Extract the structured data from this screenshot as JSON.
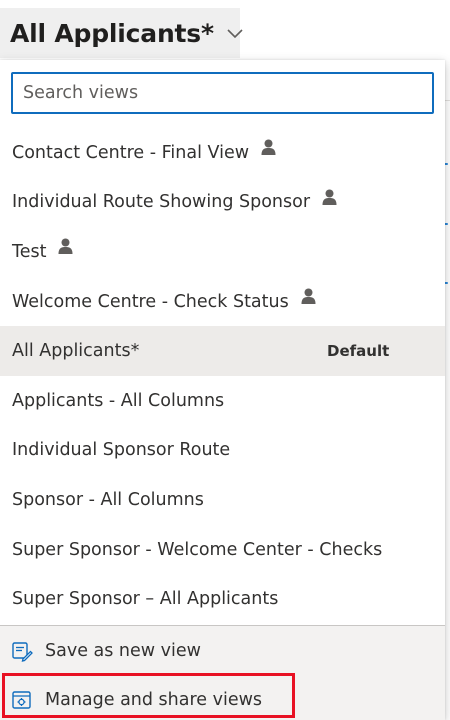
{
  "header": {
    "title": "All Applicants*"
  },
  "search": {
    "placeholder": "Search views"
  },
  "views": [
    {
      "label": "Contact Centre - Final View",
      "personal": true
    },
    {
      "label": "Individual Route Showing Sponsor",
      "personal": true
    },
    {
      "label": "Test",
      "personal": true
    },
    {
      "label": "Welcome Centre - Check Status",
      "personal": true
    },
    {
      "label": "All Applicants*",
      "selected": true,
      "tag": "Default"
    },
    {
      "label": "Applicants - All Columns"
    },
    {
      "label": "Individual Sponsor Route"
    },
    {
      "label": "Sponsor - All Columns"
    },
    {
      "label": "Super Sponsor - Welcome Center - Checks"
    },
    {
      "label": "Super Sponsor – All Applicants"
    }
  ],
  "actions": {
    "save_label": "Save as new view",
    "manage_label": "Manage and share views"
  },
  "icons": {
    "person": "person-icon",
    "chevron": "chevron-down-icon",
    "save": "save-view-icon",
    "manage": "manage-views-icon"
  },
  "colors": {
    "accent": "#0f6cbd",
    "highlight": "#e81123",
    "selected_bg": "#edebe9"
  }
}
